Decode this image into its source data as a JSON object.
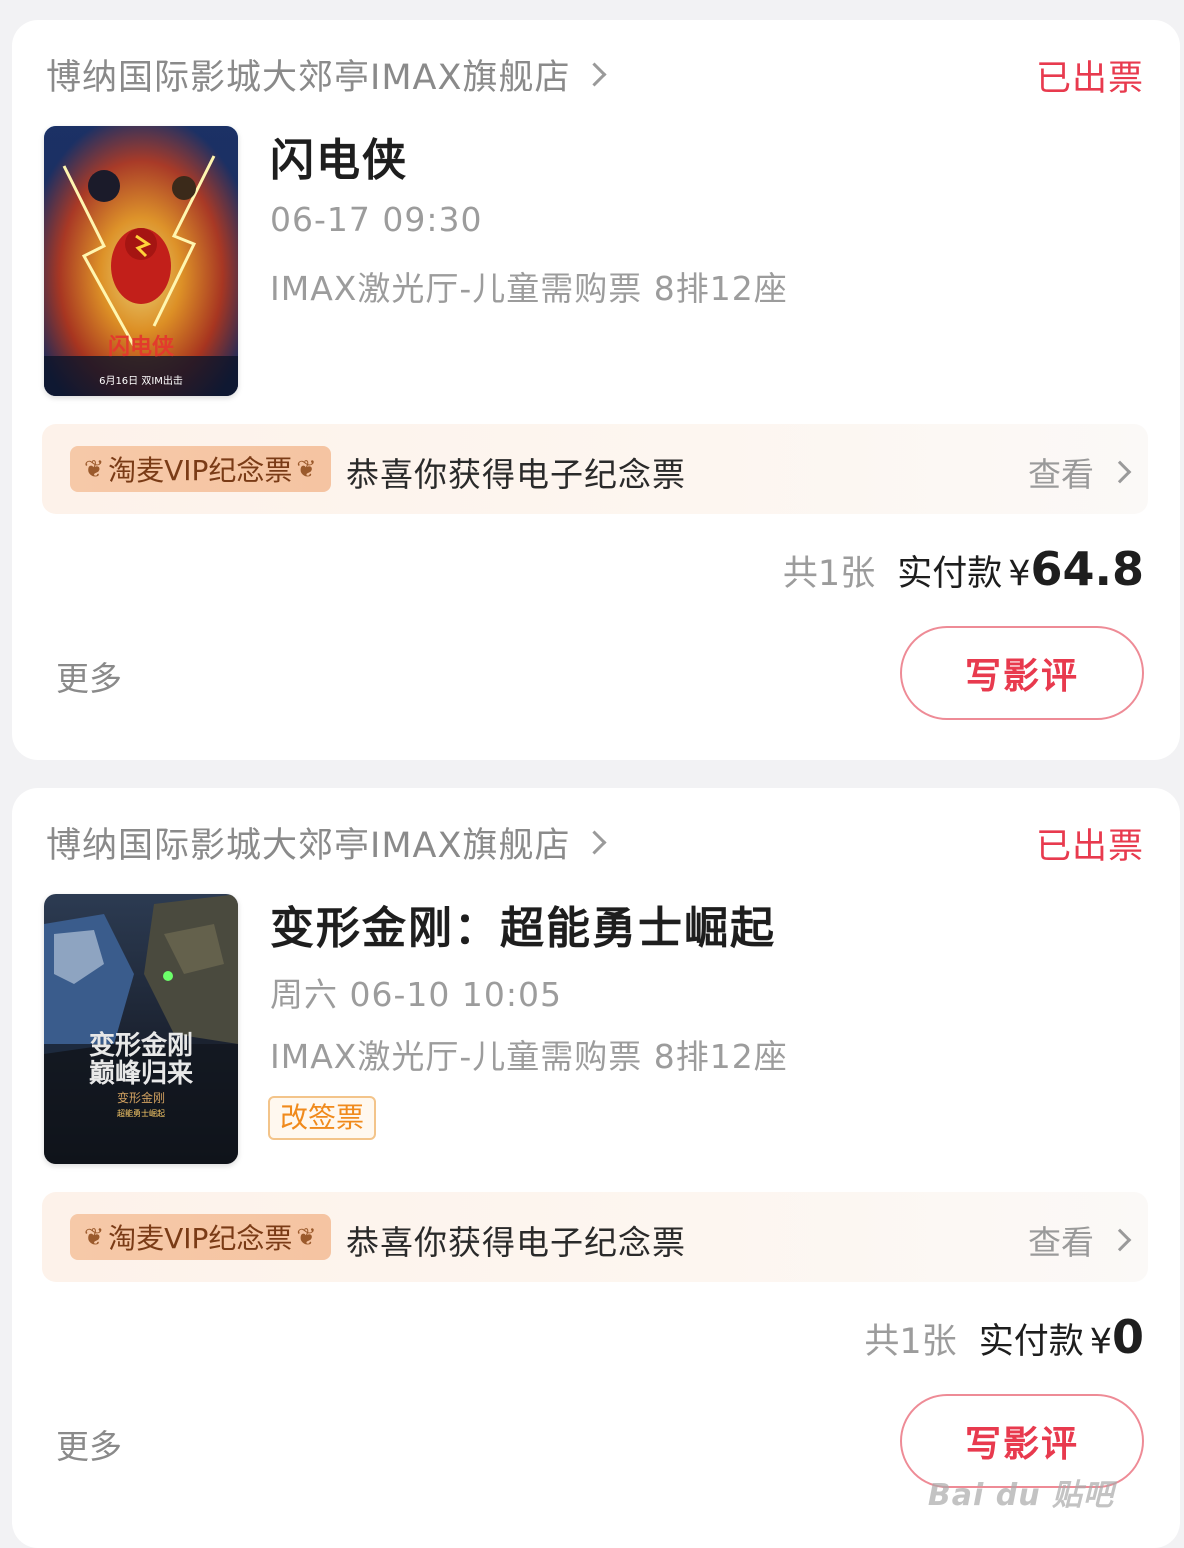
{
  "orders": [
    {
      "cinema": "博纳国际影城大郊亭IMAX旗舰店",
      "status": "已出票",
      "movie_title": "闪电侠",
      "showtime": "06-17 09:30",
      "hall_seat": "IMAX激光厅-儿童需购票 8排12座",
      "tag": "",
      "vip_badge": "淘麦VIP纪念票",
      "vip_message": "恭喜你获得电子纪念票",
      "view_label": "查看",
      "count": "共1张",
      "paid_label": "实付款",
      "currency": "¥",
      "amount": "64.8",
      "more_label": "更多",
      "review_label": "写影评"
    },
    {
      "cinema": "博纳国际影城大郊亭IMAX旗舰店",
      "status": "已出票",
      "movie_title": "变形金刚：超能勇士崛起",
      "showtime": "周六 06-10 10:05",
      "hall_seat": "IMAX激光厅-儿童需购票 8排12座",
      "tag": "改签票",
      "vip_badge": "淘麦VIP纪念票",
      "vip_message": "恭喜你获得电子纪念票",
      "view_label": "查看",
      "count": "共1张",
      "paid_label": "实付款",
      "currency": "¥",
      "amount": "0",
      "more_label": "更多",
      "review_label": "写影评"
    }
  ],
  "colors": {
    "accent_red": "#e83a4e",
    "tag_orange": "#f08a1c",
    "muted_text": "#9c9c9c"
  },
  "watermark": "Bai du 贴吧"
}
